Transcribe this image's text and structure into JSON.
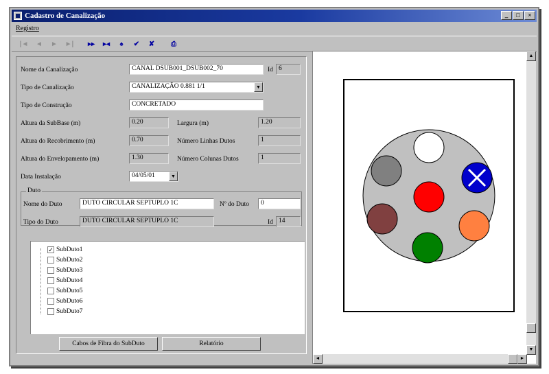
{
  "window": {
    "title": "Cadastro de Canalização"
  },
  "menu": {
    "items": [
      "Registro"
    ]
  },
  "toolbar": {
    "buttons": [
      {
        "name": "first-record-button",
        "glyph": "|◄",
        "disabled": true
      },
      {
        "name": "prev-record-button",
        "glyph": "◄",
        "disabled": true
      },
      {
        "name": "next-record-button",
        "glyph": "►",
        "disabled": true
      },
      {
        "name": "last-record-button",
        "glyph": "►|",
        "disabled": true
      },
      {
        "name": "sep",
        "glyph": "",
        "disabled": true
      },
      {
        "name": "insert-button",
        "glyph": "▸▸",
        "disabled": false
      },
      {
        "name": "delete-button",
        "glyph": "▸◂",
        "disabled": false
      },
      {
        "name": "find-button",
        "glyph": "♠",
        "disabled": false
      },
      {
        "name": "confirm-button",
        "glyph": "✔",
        "disabled": false
      },
      {
        "name": "cancel-button",
        "glyph": "✘",
        "disabled": false
      },
      {
        "name": "sep",
        "glyph": "",
        "disabled": true
      },
      {
        "name": "print-button",
        "glyph": "⎙",
        "disabled": false
      }
    ]
  },
  "form": {
    "nome_canalizacao": {
      "label": "Nome da Canalização",
      "value": "CANAL DSUB001_DSUB002_70"
    },
    "id_label": "Id",
    "id_value": "6",
    "tipo_canalizacao": {
      "label": "Tipo de Canalização",
      "value": "CANALIZAÇÃO 0.881 1/1"
    },
    "tipo_construcao": {
      "label": "Tipo de Construção",
      "value": "CONCRETADO"
    },
    "altura_subbase": {
      "label": "Altura da SubBase (m)",
      "value": "0.20"
    },
    "largura": {
      "label": "Largura (m)",
      "value": "1.20"
    },
    "altura_recobrimento": {
      "label": "Altura do Recobrimento (m)",
      "value": "0.70"
    },
    "numero_linhas": {
      "label": "Número Linhas Dutos",
      "value": "1"
    },
    "altura_envelopamento": {
      "label": "Altura do Envelopamento (m)",
      "value": "1.30"
    },
    "numero_colunas": {
      "label": "Número Colunas Dutos",
      "value": "1"
    },
    "data_instalacao": {
      "label": "Data Instalação",
      "value": "04/05/01"
    }
  },
  "duto": {
    "group_label": "Duto",
    "nome": {
      "label": "Nome do Duto",
      "value": "DUTO CIRCULAR SEPTUPLO 1C"
    },
    "numero": {
      "label": "Nº do Duto",
      "value": "0"
    },
    "tipo": {
      "label": "Tipo do Duto",
      "value": "DUTO CIRCULAR SEPTUPLO 1C"
    },
    "id_label": "Id",
    "id_value": "14"
  },
  "subdutos": [
    {
      "label": "SubDuto1",
      "checked": true
    },
    {
      "label": "SubDuto2",
      "checked": false
    },
    {
      "label": "SubDuto3",
      "checked": false
    },
    {
      "label": "SubDuto4",
      "checked": false
    },
    {
      "label": "SubDuto5",
      "checked": false
    },
    {
      "label": "SubDuto6",
      "checked": false
    },
    {
      "label": "SubDuto7",
      "checked": false
    }
  ],
  "buttons": {
    "cabos": "Cabos de Fibra do SubDuto",
    "relatorio": "Relatório"
  },
  "diagram": {
    "outer_fill": "#c0c0c0",
    "subducts": [
      {
        "name": "subduct-top",
        "fill": "#ffffff",
        "marked": false
      },
      {
        "name": "subduct-upper-right",
        "fill": "#0000cc",
        "marked": true
      },
      {
        "name": "subduct-lower-right",
        "fill": "#ff8040",
        "marked": false
      },
      {
        "name": "subduct-bottom",
        "fill": "#008000",
        "marked": false
      },
      {
        "name": "subduct-lower-left",
        "fill": "#804040",
        "marked": false
      },
      {
        "name": "subduct-upper-left",
        "fill": "#808080",
        "marked": false
      },
      {
        "name": "subduct-center",
        "fill": "#ff0000",
        "marked": false
      }
    ]
  }
}
